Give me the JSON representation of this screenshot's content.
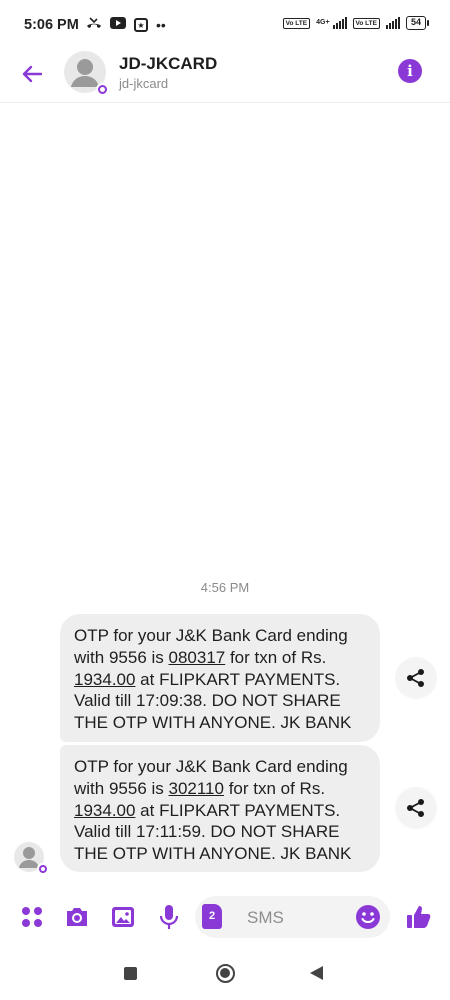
{
  "status_bar": {
    "time": "5:06 PM",
    "sim1_label": "Vo LTE",
    "network_label": "4G+",
    "sim2_label": "Vo LTE",
    "battery": "54"
  },
  "header": {
    "contact_name": "JD-JKCARD",
    "contact_sub": "jd-jkcard",
    "info_glyph": "i"
  },
  "conversation": {
    "timestamp": "4:56 PM",
    "messages": [
      {
        "pre": "OTP for your J&K Bank Card ending with 9556 is ",
        "otp": "080317",
        "mid": " for txn of Rs. ",
        "amount": "1934.00",
        "post": " at FLIPKART PAYMENTS. Valid till 17:09:38. DO NOT SHARE THE OTP WITH ANYONE. JK BANK"
      },
      {
        "pre": "OTP for your J&K Bank Card ending with 9556 is ",
        "otp": "302110",
        "mid": " for txn of Rs. ",
        "amount": "1934.00",
        "post": " at FLIPKART PAYMENTS. Valid till 17:11:59. DO NOT SHARE THE OTP WITH ANYONE. JK BANK"
      }
    ]
  },
  "composer": {
    "sim_number": "2",
    "placeholder": "SMS"
  },
  "colors": {
    "accent": "#8b39d6",
    "bubble": "#eeeeee"
  }
}
